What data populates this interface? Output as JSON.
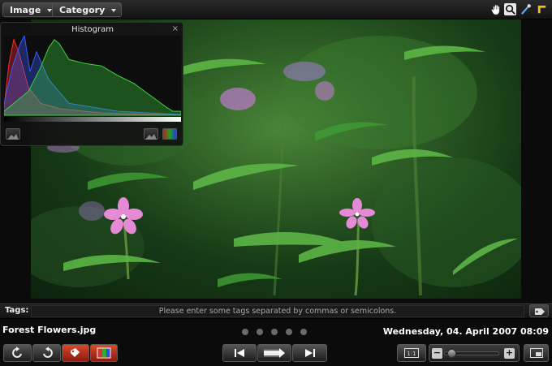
{
  "menu": {
    "image_label": "Image",
    "category_label": "Category"
  },
  "toolbar_icons": [
    "hand-icon",
    "magnifier-icon",
    "eyedropper-icon",
    "crop-icon"
  ],
  "histogram": {
    "title": "Histogram",
    "close_glyph": "×"
  },
  "chart_data": {
    "type": "area",
    "x_range": [
      0,
      255
    ],
    "series": [
      {
        "color": "#ff2a2a"
      },
      {
        "color": "#3a5bff"
      },
      {
        "color": "#3cd23c"
      }
    ]
  },
  "tags": {
    "label": "Tags:",
    "placeholder": "Please enter some tags separated by commas or semicolons."
  },
  "photo": {
    "filename": "Forest Flowers.jpg",
    "datetime": "Wednesday, 04. April 2007 08:09"
  },
  "pagination": {
    "dot_count": 5
  },
  "zoom": {
    "fit_label": "1:1",
    "minus": "−",
    "plus": "+",
    "level": 0.05
  },
  "colors": {
    "accent_red": "#c0281c",
    "bar_bg": "#161616"
  }
}
